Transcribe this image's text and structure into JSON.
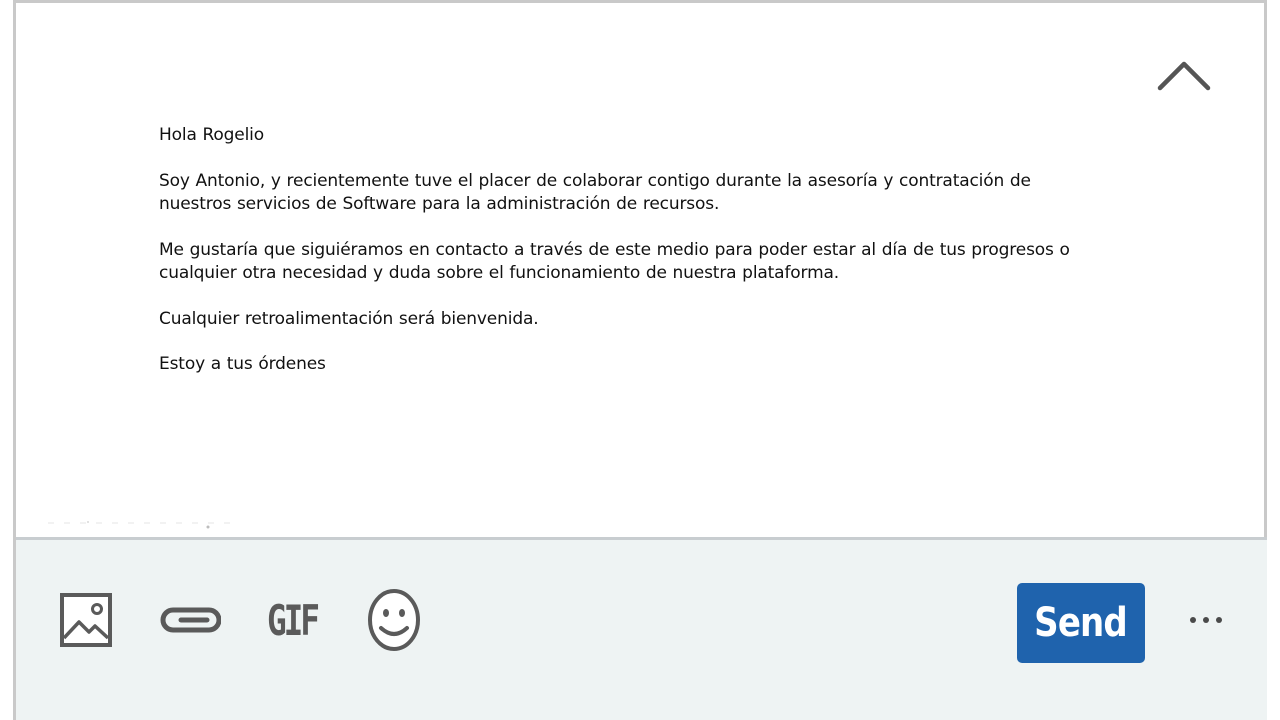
{
  "message": {
    "greeting": "Hola Rogelio",
    "paragraph1": "Soy Antonio, y recientemente tuve el placer de colaborar contigo durante la asesoría y contratación de nuestros servicios de Software para la administración de recursos.",
    "paragraph2": "Me gustaría que siguiéramos en contacto a través de este medio para poder estar al día de tus progresos o cualquier otra necesidad y duda sobre el funcionamiento de nuestra plataforma.",
    "paragraph3": "Cualquier retroalimentación será bienvenida.",
    "closing": "Estoy a tus órdenes"
  },
  "toolbar": {
    "image_icon": "image-icon",
    "attach_icon": "paperclip-icon",
    "gif_label": "GIF",
    "emoji_icon": "emoji-icon",
    "send_label": "Send",
    "more_label": "···"
  },
  "header": {
    "collapse_icon": "chevron-up-icon"
  },
  "colors": {
    "send_button": "#1f63ad",
    "toolbar_bg": "#eef3f3",
    "icon_gray": "#5a5a5a"
  }
}
